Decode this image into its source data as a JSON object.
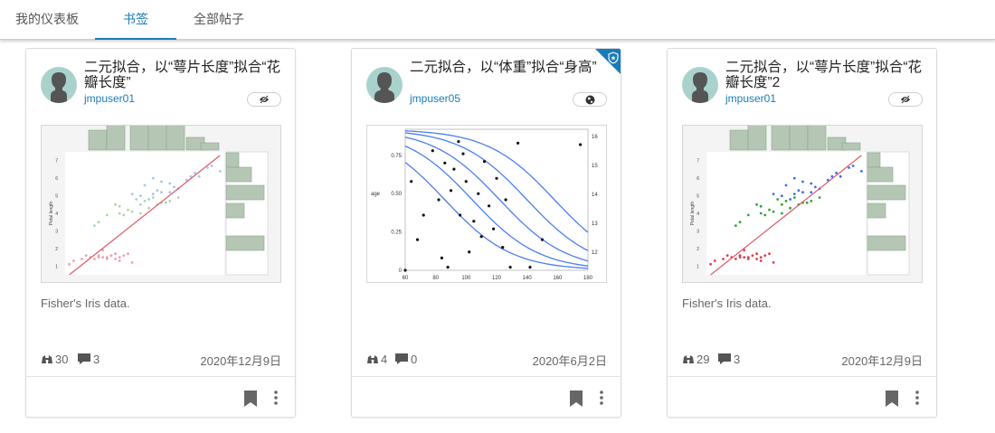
{
  "tabs": [
    {
      "label": "我的仪表板",
      "active": false
    },
    {
      "label": "书签",
      "active": true
    },
    {
      "label": "全部帖子",
      "active": false
    }
  ],
  "colors": {
    "accent": "#1a7bb9",
    "hist": "#b5c7b4",
    "red": "#e05a6a",
    "blue": "#4e86f0",
    "green": "#3aa845"
  },
  "cards": [
    {
      "title": "二元拟合，以“萼片长度”拟合“花瓣长度”",
      "author": "jmpuser01",
      "visibility_icon": "eye-off-icon",
      "description": "Fisher's Iris data.",
      "views": "30",
      "comments": "3",
      "date": "2020年12月9日",
      "chart_data": {
        "type": "scatter",
        "ylabel": "Petal length",
        "yticks": [
          "1",
          "2",
          "3",
          "4",
          "5",
          "6",
          "7"
        ],
        "ylim": [
          0.5,
          7.5
        ],
        "series": [
          {
            "color": "#e8a2b0",
            "points": [
              [
                4.6,
                1.4
              ],
              [
                4.8,
                1.5
              ],
              [
                5.0,
                1.6
              ],
              [
                5.2,
                1.5
              ],
              [
                5.4,
                1.7
              ],
              [
                5.5,
                1.3
              ],
              [
                4.9,
                1.4
              ],
              [
                5.1,
                1.5
              ],
              [
                5.3,
                1.6
              ],
              [
                5.7,
                1.7
              ],
              [
                5.8,
                1.2
              ],
              [
                4.4,
                1.3
              ],
              [
                4.7,
                1.6
              ],
              [
                5.0,
                1.5
              ],
              [
                5.4,
                1.4
              ],
              [
                5.6,
                1.6
              ],
              [
                5.1,
                1.9
              ],
              [
                4.3,
                1.1
              ],
              [
                5.2,
                1.4
              ],
              [
                5.5,
                1.5
              ]
            ]
          },
          {
            "color": "#a8d8a8",
            "points": [
              [
                5.0,
                3.5
              ],
              [
                5.5,
                4.0
              ],
              [
                5.7,
                4.2
              ],
              [
                6.0,
                4.5
              ],
              [
                6.2,
                4.3
              ],
              [
                6.4,
                4.5
              ],
              [
                5.8,
                4.1
              ],
              [
                5.6,
                3.9
              ],
              [
                6.1,
                4.7
              ],
              [
                6.3,
                4.9
              ],
              [
                5.9,
                4.8
              ],
              [
                6.6,
                4.6
              ],
              [
                6.7,
                4.7
              ],
              [
                5.2,
                3.9
              ],
              [
                5.4,
                4.5
              ],
              [
                6.5,
                4.6
              ],
              [
                4.9,
                3.3
              ],
              [
                6.9,
                4.9
              ],
              [
                5.5,
                4.4
              ],
              [
                6.0,
                4.0
              ]
            ]
          },
          {
            "color": "#a8c4ee",
            "points": [
              [
                6.3,
                6.0
              ],
              [
                6.5,
                5.8
              ],
              [
                7.1,
                5.9
              ],
              [
                6.7,
                5.7
              ],
              [
                7.2,
                6.1
              ],
              [
                6.4,
                5.3
              ],
              [
                6.8,
                5.5
              ],
              [
                6.9,
                5.4
              ],
              [
                7.7,
                6.7
              ],
              [
                7.6,
                6.6
              ],
              [
                6.0,
                5.0
              ],
              [
                6.2,
                4.8
              ],
              [
                6.1,
                5.6
              ],
              [
                7.4,
                6.1
              ],
              [
                6.7,
                5.2
              ],
              [
                6.3,
                5.1
              ],
              [
                5.8,
                5.1
              ],
              [
                7.9,
                6.4
              ],
              [
                6.5,
                5.2
              ],
              [
                7.3,
                6.3
              ]
            ]
          }
        ],
        "fit": [
          [
            4.3,
            0.5
          ],
          [
            7.9,
            7.3
          ]
        ]
      }
    },
    {
      "title": "二元拟合，以“体重”拟合“身高”",
      "author": "jmpuser05",
      "visibility_icon": "globe-icon",
      "description": "",
      "views": "4",
      "comments": "0",
      "date": "2020年6月2日",
      "chart_data": {
        "type": "scatter",
        "ylabel": "age",
        "xticks": [
          "60",
          "80",
          "100",
          "120",
          "140",
          "160",
          "180"
        ],
        "yticks": [
          "0",
          "0.25",
          "0.50",
          "0.75"
        ],
        "y2ticks": [
          "12",
          "13",
          "14",
          "15",
          "16"
        ],
        "xlim": [
          60,
          180
        ],
        "ylim": [
          0,
          0.92
        ],
        "points": [
          [
            64,
            0.58
          ],
          [
            68,
            0.2
          ],
          [
            78,
            0.78
          ],
          [
            82,
            0.46
          ],
          [
            84,
            0.08
          ],
          [
            86,
            0.7
          ],
          [
            90,
            0.52
          ],
          [
            92,
            0.66
          ],
          [
            96,
            0.36
          ],
          [
            98,
            0.76
          ],
          [
            100,
            0.58
          ],
          [
            102,
            0.12
          ],
          [
            105,
            0.32
          ],
          [
            108,
            0.5
          ],
          [
            110,
            0.22
          ],
          [
            112,
            0.71
          ],
          [
            115,
            0.42
          ],
          [
            118,
            0.27
          ],
          [
            120,
            0.6
          ],
          [
            124,
            0.15
          ],
          [
            126,
            0.46
          ],
          [
            129,
            0.02
          ],
          [
            134,
            0.83
          ],
          [
            142,
            0.02
          ],
          [
            150,
            0.2
          ],
          [
            175,
            0.82
          ],
          [
            88,
            0.02
          ],
          [
            95,
            0.84
          ],
          [
            72,
            0.36
          ],
          [
            60,
            0.0
          ]
        ],
        "curves": [
          {
            "midpoint": 86,
            "scale": 22
          },
          {
            "midpoint": 104,
            "scale": 22
          },
          {
            "midpoint": 122,
            "scale": 22
          },
          {
            "midpoint": 140,
            "scale": 22
          },
          {
            "midpoint": 158,
            "scale": 22
          }
        ]
      }
    },
    {
      "title": "二元拟合，以“萼片长度”拟合“花瓣长度”2",
      "author": "jmpuser01",
      "visibility_icon": "eye-off-icon",
      "description": "Fisher's Iris data.",
      "views": "29",
      "comments": "3",
      "date": "2020年12月9日",
      "chart_data": {
        "type": "scatter",
        "ylabel": "Petal length",
        "yticks": [
          "1",
          "2",
          "3",
          "4",
          "5",
          "6",
          "7"
        ],
        "ylim": [
          0.5,
          7.5
        ],
        "series": [
          {
            "color": "#e23c4e",
            "points": [
              [
                4.6,
                1.4
              ],
              [
                4.8,
                1.5
              ],
              [
                5.0,
                1.6
              ],
              [
                5.2,
                1.5
              ],
              [
                5.4,
                1.7
              ],
              [
                5.5,
                1.3
              ],
              [
                4.9,
                1.4
              ],
              [
                5.1,
                1.5
              ],
              [
                5.3,
                1.6
              ],
              [
                5.7,
                1.7
              ],
              [
                5.8,
                1.2
              ],
              [
                4.4,
                1.3
              ],
              [
                4.7,
                1.6
              ],
              [
                5.0,
                1.5
              ],
              [
                5.4,
                1.4
              ],
              [
                5.6,
                1.6
              ],
              [
                5.1,
                1.9
              ],
              [
                4.3,
                1.1
              ],
              [
                5.2,
                1.4
              ],
              [
                5.5,
                1.5
              ]
            ]
          },
          {
            "color": "#2fa53a",
            "points": [
              [
                5.0,
                3.5
              ],
              [
                5.5,
                4.0
              ],
              [
                5.7,
                4.2
              ],
              [
                6.0,
                4.5
              ],
              [
                6.2,
                4.3
              ],
              [
                6.4,
                4.5
              ],
              [
                5.8,
                4.1
              ],
              [
                5.6,
                3.9
              ],
              [
                6.1,
                4.7
              ],
              [
                6.3,
                4.9
              ],
              [
                5.9,
                4.8
              ],
              [
                6.6,
                4.6
              ],
              [
                6.7,
                4.7
              ],
              [
                5.2,
                3.9
              ],
              [
                5.4,
                4.5
              ],
              [
                6.5,
                4.6
              ],
              [
                4.9,
                3.3
              ],
              [
                6.9,
                4.9
              ],
              [
                5.5,
                4.4
              ],
              [
                6.0,
                4.0
              ]
            ]
          },
          {
            "color": "#3d6fe8",
            "points": [
              [
                6.3,
                6.0
              ],
              [
                6.5,
                5.8
              ],
              [
                7.1,
                5.9
              ],
              [
                6.7,
                5.7
              ],
              [
                7.2,
                6.1
              ],
              [
                6.4,
                5.3
              ],
              [
                6.8,
                5.5
              ],
              [
                6.9,
                5.4
              ],
              [
                7.7,
                6.7
              ],
              [
                7.6,
                6.6
              ],
              [
                6.0,
                5.0
              ],
              [
                6.2,
                4.8
              ],
              [
                6.1,
                5.6
              ],
              [
                7.4,
                6.1
              ],
              [
                6.7,
                5.2
              ],
              [
                6.3,
                5.1
              ],
              [
                5.8,
                5.1
              ],
              [
                7.9,
                6.4
              ],
              [
                6.5,
                5.2
              ],
              [
                7.3,
                6.3
              ]
            ]
          }
        ],
        "fit": [
          [
            4.3,
            0.5
          ],
          [
            7.9,
            7.3
          ]
        ]
      }
    }
  ]
}
